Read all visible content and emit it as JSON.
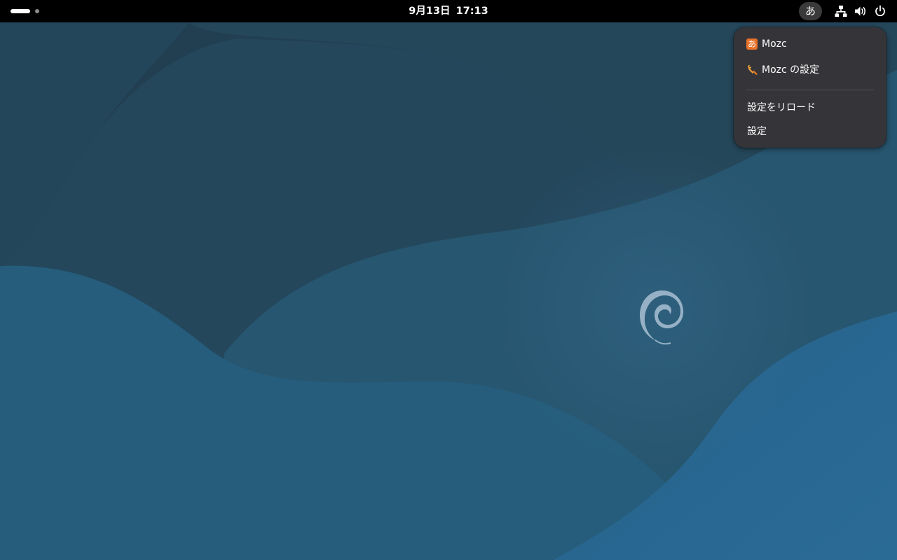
{
  "topbar": {
    "clock": {
      "date": "9月13日",
      "time": "17:13"
    },
    "ime_indicator": "あ",
    "tray_icons": [
      "network-icon",
      "volume-icon",
      "power-icon"
    ]
  },
  "ime_menu": {
    "items": [
      {
        "label": "Mozc",
        "icon": "mozc-icon",
        "icon_glyph": "あ"
      },
      {
        "label": "Mozc の設定",
        "icon": "wrench-icon"
      },
      {
        "label": "設定をリロード"
      },
      {
        "label": "設定"
      }
    ]
  },
  "wallpaper": {
    "logo": "debian-swirl-logo"
  },
  "colors": {
    "topbar": "#000000",
    "menu_background": "#353539",
    "ime_pill": "#3a3a3a",
    "mozc_accent": "#e8722a",
    "wallpaper_base": "#24475e"
  }
}
